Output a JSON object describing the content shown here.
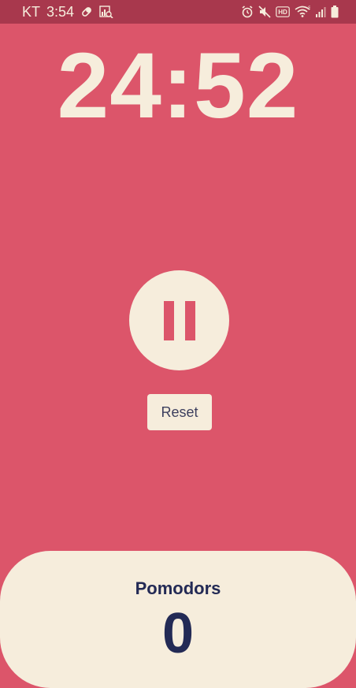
{
  "status_bar": {
    "carrier": "KT",
    "time": "3:54",
    "icons_left": [
      "pill-icon",
      "chart-search-icon"
    ],
    "icons_right": [
      "alarm-icon",
      "mute-icon",
      "hd-icon",
      "wifi-icon",
      "signal-icon",
      "battery-icon"
    ]
  },
  "timer": {
    "display": "24:52"
  },
  "controls": {
    "pause_icon": "pause-icon",
    "reset_label": "Reset"
  },
  "pomodoros": {
    "title": "Pomodors",
    "count": "0"
  },
  "colors": {
    "background": "#DC556A",
    "status_bar": "#A8384D",
    "cream": "#F6EDDC",
    "navy": "#232A55"
  }
}
